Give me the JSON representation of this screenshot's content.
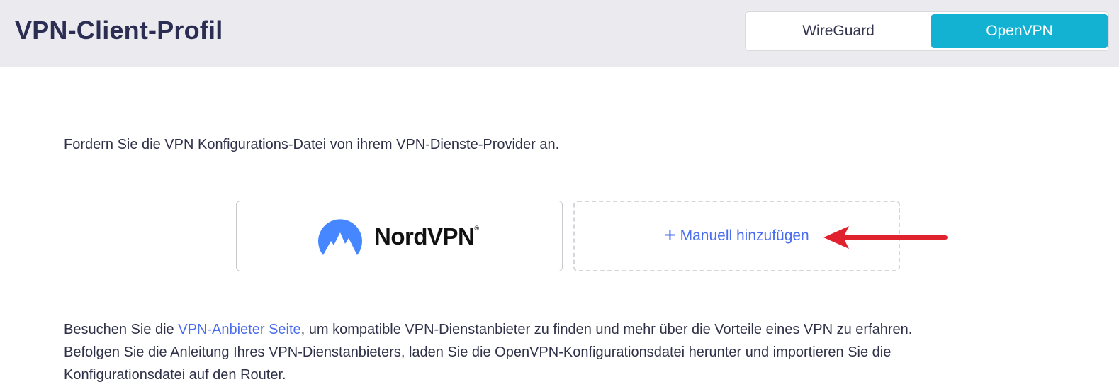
{
  "header": {
    "title": "VPN-Client-Profil",
    "tabs": [
      {
        "label": "WireGuard",
        "selected": false
      },
      {
        "label": "OpenVPN",
        "selected": true
      }
    ]
  },
  "main": {
    "intro": "Fordern Sie die VPN Konfigurations-Datei von ihrem VPN-Dienste-Provider an.",
    "provider_card": {
      "name": "NordVPN",
      "mark": "®",
      "icon": "nordvpn-mountain-logo"
    },
    "manual_add": {
      "icon": "plus-icon",
      "plus": "+",
      "label": "Manuell hinzufügen"
    },
    "annotation": {
      "icon": "red-arrow-pointing-left",
      "color": "#e0222e"
    },
    "info": {
      "part1": "Besuchen Sie die ",
      "link": "VPN-Anbieter Seite",
      "part2": ", um kompatible VPN-Dienstanbieter zu finden und mehr über die Vorteile eines VPN zu erfahren.",
      "line2": "Befolgen Sie die Anleitung Ihres VPN-Dienstanbieters, laden Sie die OpenVPN-Konfigurationsdatei herunter und importieren Sie die",
      "line3": "Konfigurationsdatei auf den Router."
    }
  },
  "colors": {
    "accent": "#14b2d2",
    "link": "#4a6cf0",
    "title": "#2b2d52",
    "header_bg": "#ebebef"
  }
}
